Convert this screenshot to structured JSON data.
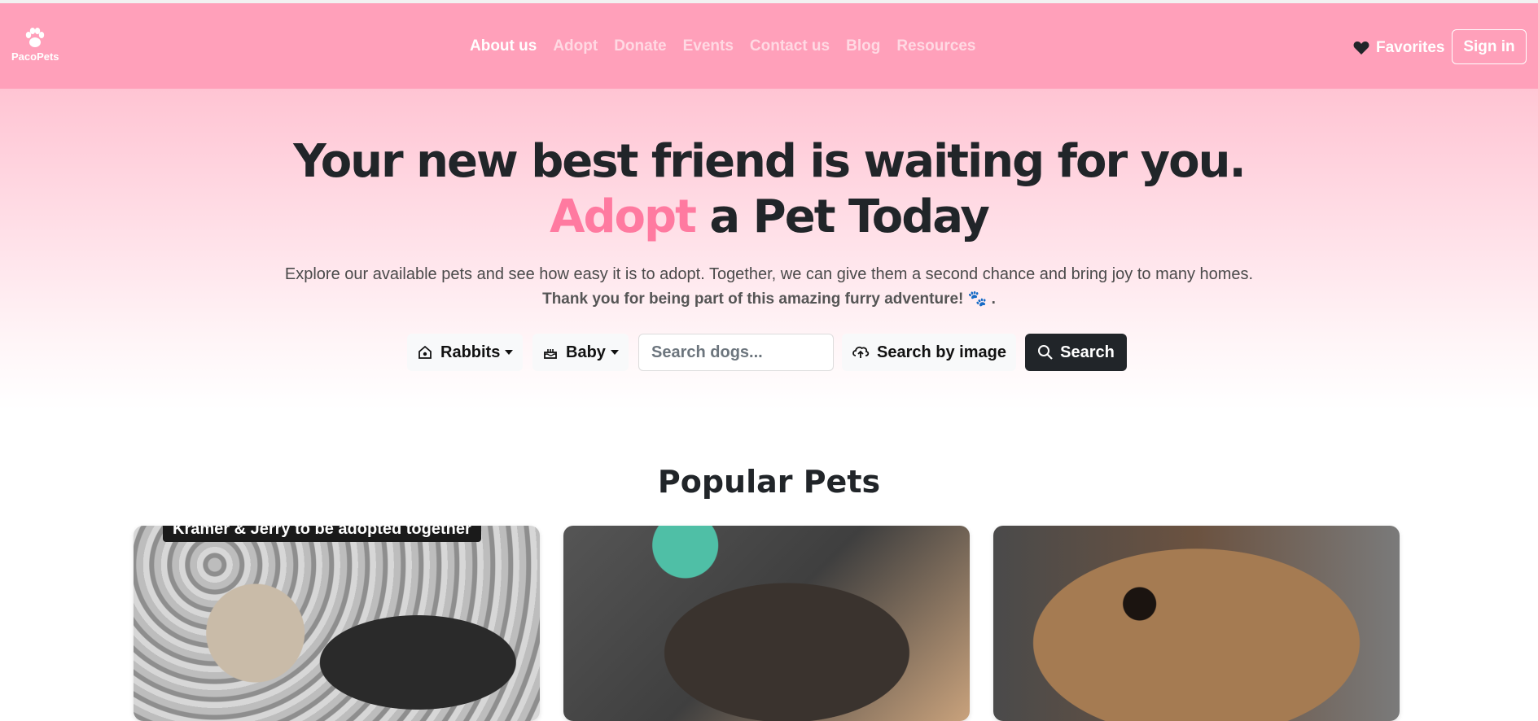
{
  "brand": {
    "name": "PacoPets"
  },
  "nav": {
    "links": [
      "About us",
      "Adopt",
      "Donate",
      "Events",
      "Contact us",
      "Blog",
      "Resources"
    ],
    "active": "About us",
    "favorites_label": "Favorites",
    "signin_label": "Sign in"
  },
  "hero": {
    "title_line1": "Your new best friend is waiting for you.",
    "title_accent": "Adopt",
    "title_line2_rest": " a Pet Today",
    "description": "Explore our available pets and see how easy it is to adopt. Together, we can give them a second chance and bring joy to many homes.",
    "thanks": "Thank you for being part of this amazing furry adventure!",
    "thanks_emoji": "🐾",
    "thanks_end": "."
  },
  "search": {
    "pet_type": {
      "label": "Rabbits",
      "icon": "pet-house-icon"
    },
    "age": {
      "label": "Baby",
      "icon": "cake-icon"
    },
    "input_placeholder": "Search dogs...",
    "image_search_label": "Search by image",
    "search_label": "Search"
  },
  "popular": {
    "title": "Popular Pets",
    "cards": [
      {
        "caption": "Kramer & Jerry to be adopted together"
      },
      {
        "caption": ""
      },
      {
        "caption": ""
      }
    ]
  },
  "colors": {
    "navbar": "#ffa0ba",
    "accent": "#ff7aa0",
    "dark": "#212529"
  }
}
